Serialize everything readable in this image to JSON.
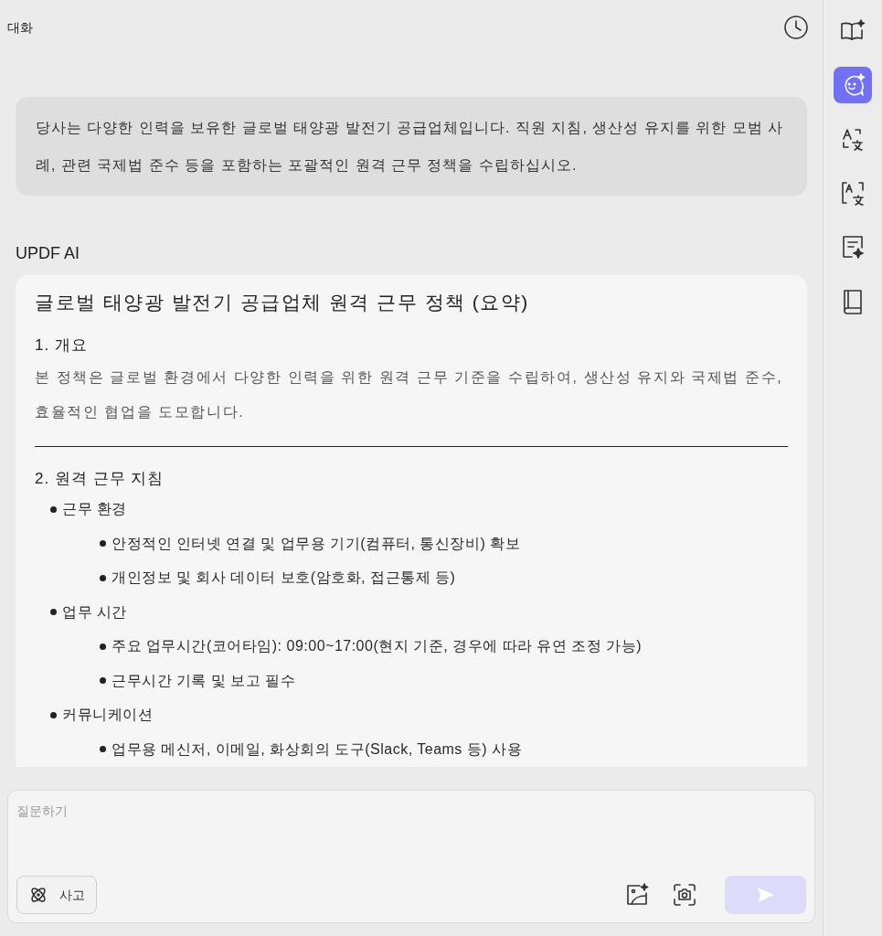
{
  "header": {
    "title": "대화"
  },
  "sidebar": {
    "items": [
      {
        "kind": "book-sparkle",
        "selected": false
      },
      {
        "kind": "chat",
        "selected": true
      },
      {
        "kind": "translate",
        "selected": false
      },
      {
        "kind": "translate-box",
        "selected": false
      },
      {
        "kind": "note-sparkle",
        "selected": false
      },
      {
        "kind": "book",
        "selected": false
      }
    ]
  },
  "user_message": "당사는 다양한 인력을 보유한 글로벌 태양광 발전기 공급업체입니다. 직원 지침, 생산성 유지를 위한 모범 사례, 관련 국제법 준수 등을 포함하는 포괄적인 원격 근무 정책을 수립하십시오.",
  "assistant": {
    "name": "UPDF AI",
    "title": "글로벌 태양광 발전기 공급업체 원격 근무 정책 (요약)",
    "sections": [
      {
        "heading": "1. 개요",
        "paragraph": "본 정책은 글로벌 환경에서 다양한 인력을 위한 원격 근무 기준을 수립하여, 생산성 유지와 국제법 준수, 효율적인 협업을 도모합니다.",
        "divider": true
      },
      {
        "heading": "2. 원격 근무 지침",
        "items": [
          {
            "text": "근무 환경",
            "children": [
              {
                "text": "안정적인 인터넷 연결 및 업무용 기기(컴퓨터, 통신장비) 확보"
              },
              {
                "text": "개인정보 및 회사 데이터 보호(암호화, 접근통제 등)"
              }
            ]
          },
          {
            "text": "업무 시간",
            "children": [
              {
                "text": "주요 업무시간(코어타임): 09:00~17:00(현지 기준, 경우에 따라 유연 조정 가능)"
              },
              {
                "text": "근무시간 기록 및 보고 필수"
              }
            ]
          },
          {
            "text": "커뮤니케이션",
            "children": [
              {
                "text": "업무용 메신저, 이메일, 화상회의 도구(Slack, Teams 등) 사용"
              }
            ]
          }
        ]
      }
    ]
  },
  "composer": {
    "placeholder": "질문하기",
    "think_button": "사고",
    "send_disabled": true
  }
}
